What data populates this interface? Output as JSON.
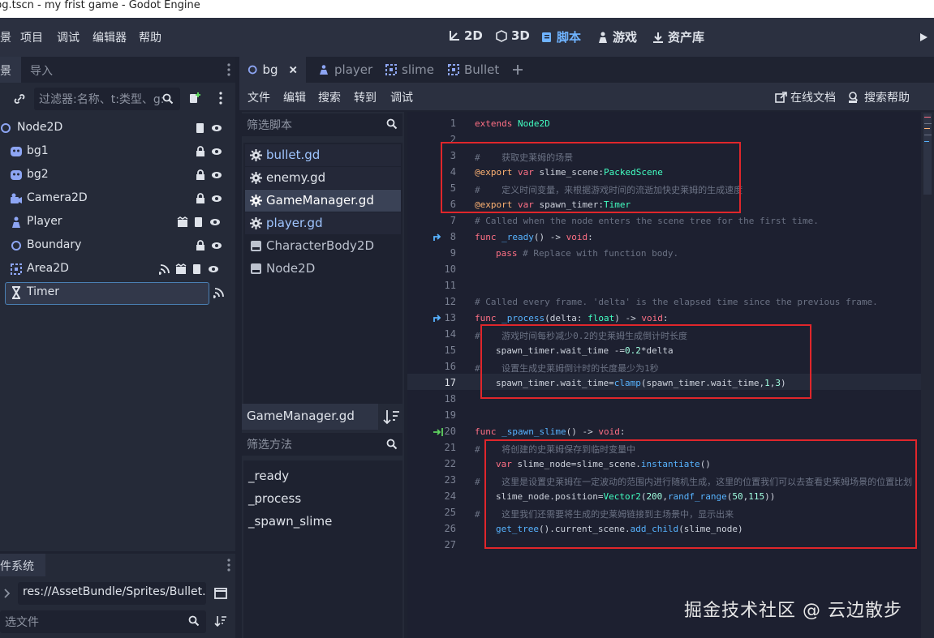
{
  "window": {
    "title": "bg.tscn - my frist game - Godot Engine"
  },
  "menu": {
    "items": [
      "景",
      "项目",
      "调试",
      "编辑器",
      "帮助"
    ]
  },
  "workspaces": {
    "w2d": "2D",
    "w3d": "3D",
    "script": "脚本",
    "game": "游戏",
    "assets": "资产库"
  },
  "scene_dock": {
    "tab_scene": "景",
    "tab_import": "导入",
    "filter_placeholder": "过滤器:名称、t:类型、g:",
    "nodes": [
      "Node2D",
      "bg1",
      "bg2",
      "Camera2D",
      "Player",
      "Boundary",
      "Area2D",
      "Timer"
    ]
  },
  "filesystem": {
    "tab": "件系统",
    "path": "res://AssetBundle/Sprites/Bullet.",
    "filter_placeholder": "选文件"
  },
  "script_tabs": [
    "bg",
    "player",
    "slime",
    "Bullet"
  ],
  "script_menu": {
    "file": "文件",
    "edit": "编辑",
    "search": "搜索",
    "goto": "转到",
    "debug": "调试",
    "online_docs": "在线文档",
    "search_help": "搜索帮助"
  },
  "script_list": {
    "filter_placeholder": "筛选脚本",
    "files": [
      "bullet.gd",
      "enemy.gd",
      "GameManager.gd",
      "player.gd",
      "CharacterBody2D",
      "Node2D"
    ],
    "current_name": "GameManager.gd",
    "method_filter_placeholder": "筛选方法",
    "methods": [
      "_ready",
      "_process",
      "_spawn_slime"
    ]
  },
  "editor": {
    "line_numbers": [
      "1",
      "2",
      "3",
      "4",
      "5",
      "6",
      "7",
      "8",
      "9",
      "10",
      "11",
      "12",
      "13",
      "14",
      "15",
      "16",
      "17",
      "18",
      "19",
      "20",
      "21",
      "22",
      "23",
      "24",
      "25",
      "26",
      "27"
    ],
    "code": {
      "l1a": "extends",
      "l1b": "Node2D",
      "l3": "#    获取史莱姆的场景",
      "l4a": "@export",
      "l4b": "var",
      "l4c": "slime_scene:",
      "l4d": "PackedScene",
      "l5": "#    定义时间变量，来根据游戏时间的流逝加快史莱姆的生成速度",
      "l6a": "@export",
      "l6b": "var",
      "l6c": "spawn_timer:",
      "l6d": "Timer",
      "l7": "# Called when the node enters the scene tree for the first time.",
      "l8a": "func",
      "l8b": "_ready",
      "l8c": "() -> ",
      "l8d": "void",
      "l8e": ":",
      "l9a": "pass",
      "l9b": "# Replace with function body.",
      "l12": "# Called every frame. 'delta' is the elapsed time since the previous frame.",
      "l13a": "func",
      "l13b": "_process",
      "l13c": "(delta: ",
      "l13d": "float",
      "l13e": ") -> ",
      "l13f": "void",
      "l13g": ":",
      "l14": "#    游戏时间每秒减少0.2的史莱姆生成倒计时长度",
      "l15a": "spawn_timer.wait_time -=",
      "l15b": "0.2",
      "l15c": "*delta",
      "l16": "#    设置生成史莱姆倒计时的长度最少为1秒",
      "l17a": "spawn_timer.wait_time=",
      "l17b": "clamp",
      "l17c": "(spawn_timer.wait_time,",
      "l17d": "1",
      "l17e": ",",
      "l17f": "3",
      "l17g": ")",
      "l20a": "func",
      "l20b": "_spawn_slime",
      "l20c": "() -> ",
      "l20d": "void",
      "l20e": ":",
      "l21": "#    将创建的史莱姆保存到临时变量中",
      "l22a": "var",
      "l22b": "slime_node=slime_scene.",
      "l22c": "instantiate",
      "l22d": "()",
      "l23": "#    这里是设置史莱姆在一定波动的范围内进行随机生成，这里的位置我们可以去查看史莱姆场景的位置比划",
      "l24a": "slime_node.position=",
      "l24b": "Vector2",
      "l24c": "(",
      "l24d": "200",
      "l24e": ",",
      "l24f": "randf_range",
      "l24g": "(",
      "l24h": "50",
      "l24i": ",",
      "l24j": "115",
      "l24k": "))",
      "l25": "#    这里我们还需要将生成的史莱姆链接到主场景中，显示出来",
      "l26a": "get_tree",
      "l26b": "().current_scene.",
      "l26c": "add_child",
      "l26d": "(slime_node)"
    }
  },
  "watermark": "掘金技术社区 @ 云边散步",
  "colors": {
    "accent": "#6fb3ff",
    "highlight_box": "#e0262b",
    "keyword": "#ff7085",
    "type": "#42ffc2",
    "function": "#57b3ff"
  }
}
